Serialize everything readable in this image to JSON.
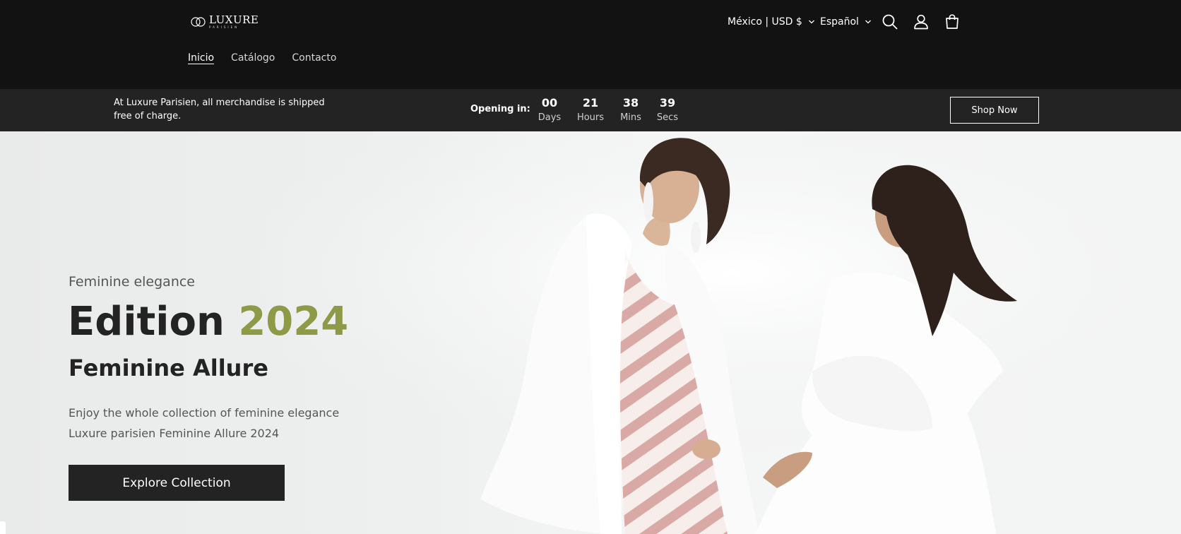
{
  "header": {
    "logo": {
      "main": "LUXURE",
      "sub": "PARISIEN"
    },
    "country_selector": "México | USD $",
    "language_selector": "Español",
    "icons": [
      "search-icon",
      "account-icon",
      "cart-icon"
    ],
    "nav": [
      {
        "label": "Inicio",
        "active": true
      },
      {
        "label": "Catálogo",
        "active": false
      },
      {
        "label": "Contacto",
        "active": false
      }
    ]
  },
  "announcement": {
    "text": "At Luxure Parisien, all merchandise is shipped free of charge.",
    "opening_label": "Opening in:",
    "countdown": [
      {
        "value": "00",
        "unit": "Days"
      },
      {
        "value": "21",
        "unit": "Hours"
      },
      {
        "value": "38",
        "unit": "Mins"
      },
      {
        "value": "39",
        "unit": "Secs"
      }
    ],
    "shop_now": "Shop Now"
  },
  "hero": {
    "eyebrow": "Feminine elegance",
    "headline_main": "Edition",
    "headline_accent": "2024",
    "subhead": "Feminine Allure",
    "description_line1": "Enjoy the whole collection of feminine elegance",
    "description_line2": "Luxure parisien Feminine Allure 2024",
    "cta": "Explore Collection"
  },
  "colors": {
    "header_bg": "#121212",
    "announcement_bg": "#232323",
    "accent": "#8e9a47",
    "text_dark": "#232323",
    "button_bg": "#232323"
  }
}
